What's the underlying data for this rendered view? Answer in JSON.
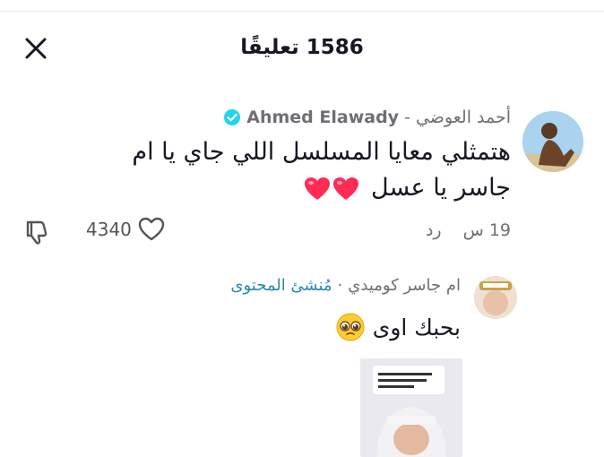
{
  "header": {
    "title": "1586 تعليقًا",
    "close_icon": "close-icon"
  },
  "comment": {
    "author_ar": "أحمد العوضي -",
    "author_latin": "Ahmed Elawady",
    "verified_icon": "verified-badge-icon",
    "text": "هتمثلي معايا المسلسل اللي جاي يا ام جاسر يا عسل",
    "emoji_hearts": 2,
    "time": "19 س",
    "reply_label": "رد",
    "like_count": "4340"
  },
  "reply": {
    "author": "ام جاسر كوميدي",
    "separator": "·",
    "creator_label": "مُنشئ المحتوى",
    "text": "بحبك اوى",
    "emoji": "pleading-face-emoji"
  },
  "colors": {
    "meta_gray": "#6e6f75",
    "creator_teal": "#2a8aa7",
    "verified_blue": "#20d5ec",
    "heart_red": "#fe2c55"
  }
}
